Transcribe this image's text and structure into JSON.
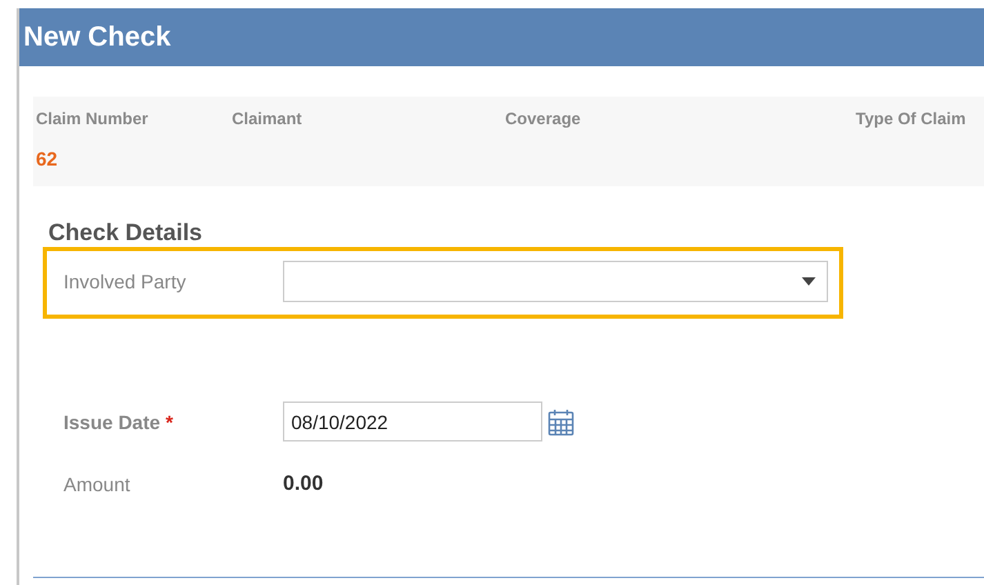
{
  "window": {
    "title": "New Check"
  },
  "summary": {
    "columns": [
      {
        "label": "Claim Number",
        "value": "62"
      },
      {
        "label": "Claimant"
      },
      {
        "label": "Coverage"
      },
      {
        "label": "Type Of Claim"
      }
    ]
  },
  "section": {
    "title": "Check Details"
  },
  "fields": [
    {
      "kind": "select",
      "label": "Involved Party",
      "highlighted": true,
      "required": false
    },
    {
      "kind": "date",
      "label": "Issue Date",
      "highlighted": false,
      "required": true,
      "required_mark": "*",
      "value": "08/10/2022"
    },
    {
      "kind": "readonly",
      "label": "Amount",
      "highlighted": false,
      "required": false,
      "value": "0.00"
    }
  ]
}
